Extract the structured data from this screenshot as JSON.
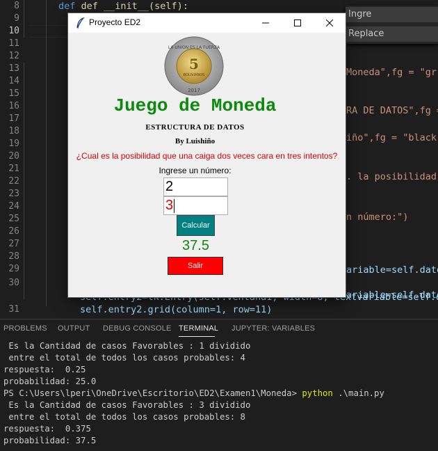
{
  "editor": {
    "line_numbers": [
      "8",
      "9",
      "10",
      "11",
      "12",
      "13",
      "14",
      "15",
      "16",
      "17",
      "18",
      "19",
      "20",
      "21",
      "22",
      "23",
      "24",
      "25",
      "26",
      "27",
      "28",
      "29",
      "30",
      "31"
    ],
    "active_line": "10",
    "visible_code": {
      "l8": "def __init__(self):",
      "l13": "Moneda\",fg = \"gr",
      "l15": "RA DE DATOS\",fg =",
      "l17": "iño\",fg = \"black\"",
      "l20": ". la posibilidad q",
      "l23": "n número:\")",
      "l27": "ariable=self.dato",
      "l29": "ariable=self.dato",
      "l30": "self.entry2=tk.Entry(self.ventana1, width=8, textvariable=self.dato",
      "l31": "self.entry2.grid(column=1, row=11)"
    }
  },
  "find_widget": {
    "find_label": "Ingre",
    "replace_label": "Replace"
  },
  "window": {
    "title": "Proyecto ED2",
    "heading": "Juego de Moneda",
    "subtitle": "ESTRUCTURA DE DATOS",
    "author": "By Luishiño",
    "question": "¿Cual es la posibilidad que una caiga dos veces cara en tres intentos?",
    "prompt": "Ingrese un número:",
    "entry1_value": "2",
    "entry2_value": "3",
    "calc_label": "Calcular",
    "result": "37.5",
    "exit_label": "Salir",
    "coin_text": {
      "top": "LA UNION ES LA FUERZA",
      "number": "5",
      "denomination": "BOLIVIANOS",
      "year": "2017"
    },
    "colors": {
      "heading": "#0b8a0b",
      "question": "#d40000",
      "calc_button": "#008080",
      "exit_button": "#ff0000"
    }
  },
  "panel": {
    "tabs": [
      "PROBLEMS",
      "OUTPUT",
      "DEBUG CONSOLE",
      "TERMINAL",
      "JUPYTER: VARIABLES"
    ],
    "active_tab": "TERMINAL",
    "terminal": {
      "l1": " Es la Cantidad de casos Favorables : 1 dividido",
      "l2": " entre el total de todos los casos probables: 4",
      "l3": "respuesta:  0.25",
      "l4": "probabilidad: 25.0",
      "prompt_path": "PS C:\\Users\\lperi\\OneDrive\\Escritorio\\ED2\\Examen1\\Moneda> ",
      "command": "python",
      "command_arg": " .\\main.py",
      "l6": " Es la Cantidad de casos Favorables : 3 dividido",
      "l7": " entre el total de todos los casos probables: 8",
      "l8": "respuesta:  0.375",
      "l9": "probabilidad: 37.5"
    }
  }
}
